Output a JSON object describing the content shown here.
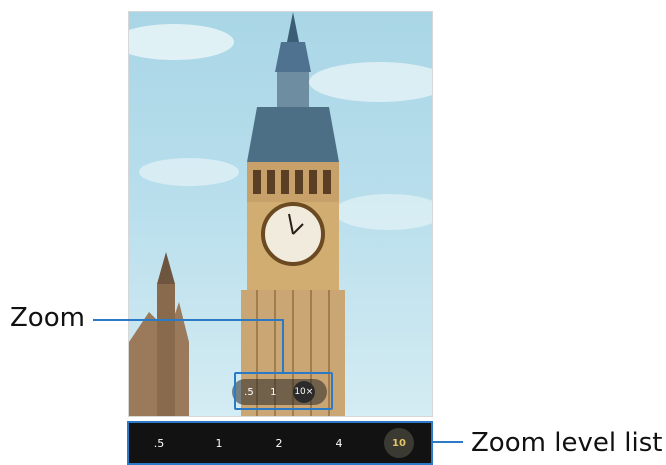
{
  "callouts": {
    "zoom_label": "Zoom",
    "zoom_level_list_label": "Zoom level list"
  },
  "viewfinder": {
    "zoom_pill": {
      "options": [
        ".5",
        "1",
        "10×"
      ],
      "active_index": 2
    }
  },
  "zoom_level_list": {
    "options": [
      ".5",
      "1",
      "2",
      "4",
      "10"
    ],
    "active_index": 4
  },
  "colors": {
    "highlight": "#2a7ac8",
    "active_zoom_text": "#e3c565",
    "bar_bg": "#121212"
  }
}
